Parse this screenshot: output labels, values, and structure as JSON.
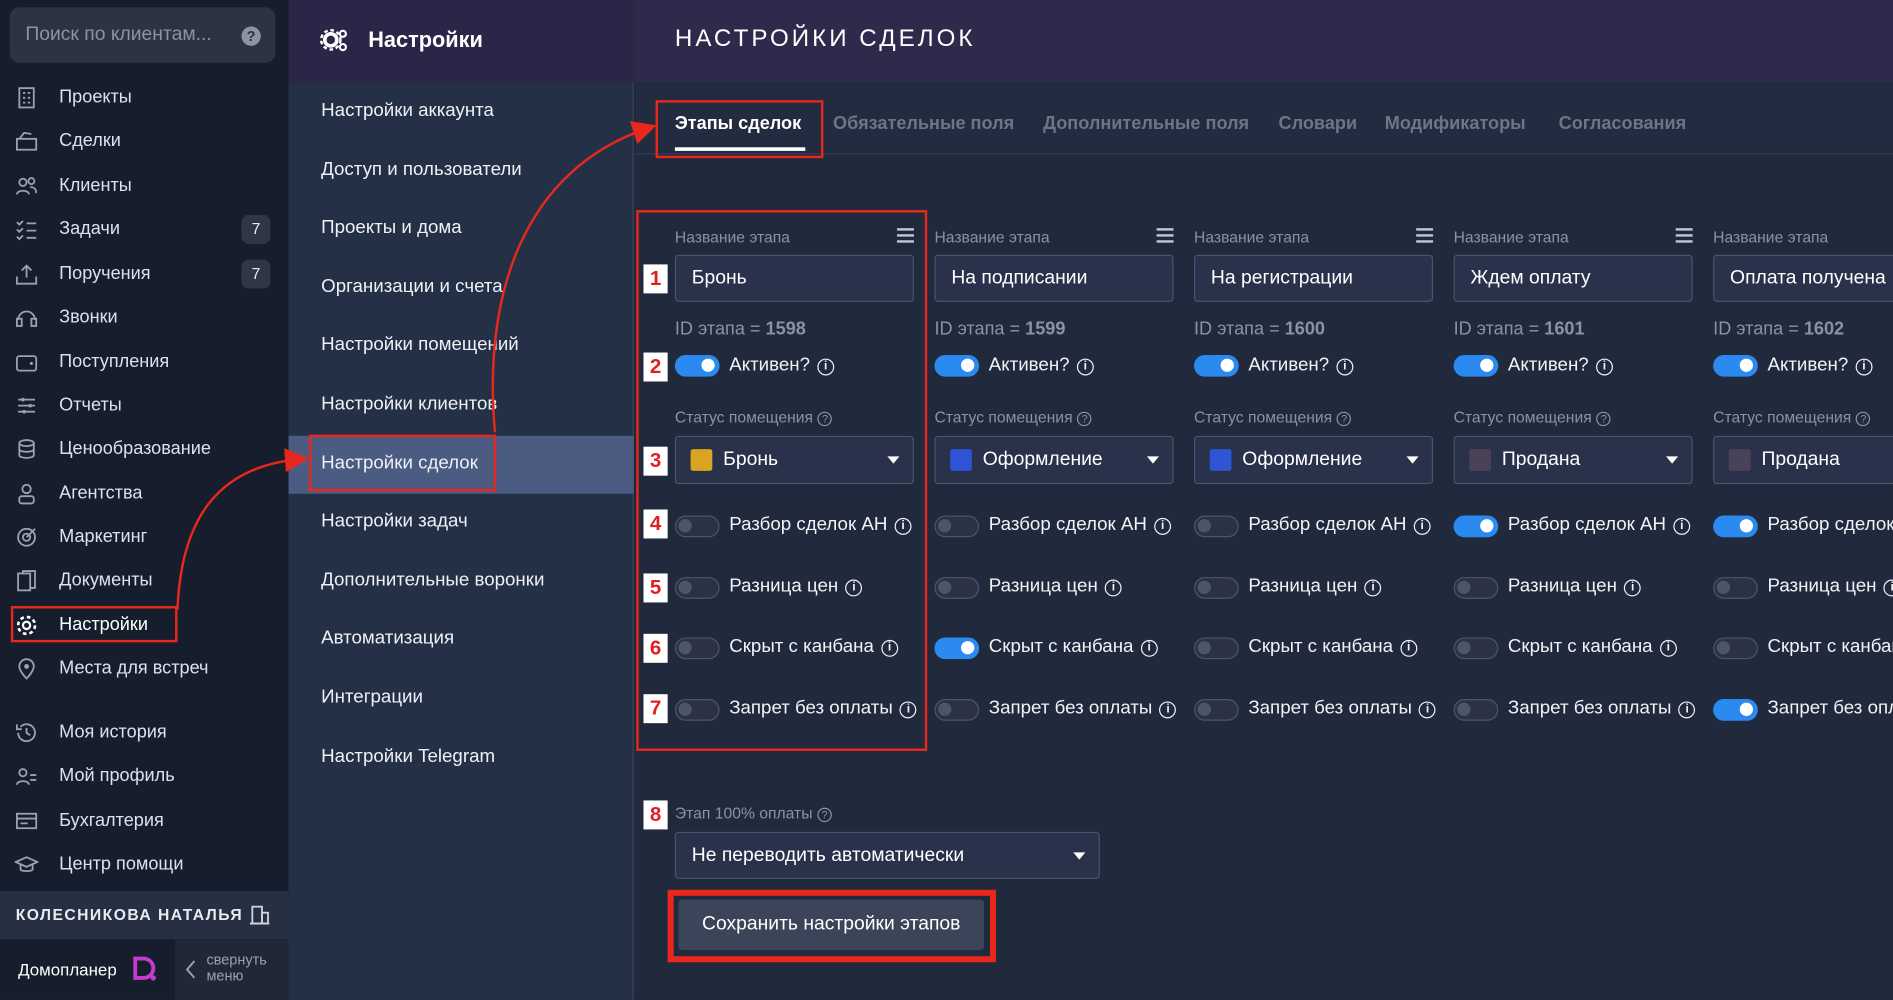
{
  "sidebar": {
    "search_placeholder": "Поиск по клиентам...",
    "items": [
      {
        "label": "Проекты",
        "icon": "building-icon"
      },
      {
        "label": "Сделки",
        "icon": "deals-icon"
      },
      {
        "label": "Клиенты",
        "icon": "users-icon"
      },
      {
        "label": "Задачи",
        "icon": "tasks-icon",
        "badge": "7"
      },
      {
        "label": "Поручения",
        "icon": "assignments-icon",
        "badge": "7"
      },
      {
        "label": "Звонки",
        "icon": "headset-icon"
      },
      {
        "label": "Поступления",
        "icon": "wallet-icon"
      },
      {
        "label": "Отчеты",
        "icon": "reports-icon"
      },
      {
        "label": "Ценообразование",
        "icon": "coins-icon"
      },
      {
        "label": "Агентства",
        "icon": "agent-icon"
      },
      {
        "label": "Маркетинг",
        "icon": "target-icon"
      },
      {
        "label": "Документы",
        "icon": "documents-icon"
      },
      {
        "label": "Настройки",
        "icon": "gear-icon"
      },
      {
        "label": "Места для встреч",
        "icon": "pin-icon"
      },
      {
        "label": "Моя история",
        "icon": "history-icon"
      },
      {
        "label": "Мой профиль",
        "icon": "profile-icon"
      },
      {
        "label": "Бухгалтерия",
        "icon": "accounting-icon"
      },
      {
        "label": "Центр помощи",
        "icon": "graduation-icon"
      }
    ],
    "user_name": "КОЛЕСНИКОВА НАТАЛЬЯ",
    "logo_text": "Домопланер",
    "collapse_label": "свернуть меню"
  },
  "settings_menu": {
    "title": "Настройки",
    "items": [
      "Настройки аккаунта",
      "Доступ и пользователи",
      "Проекты и дома",
      "Организации и счета",
      "Настройки помещений",
      "Настройки клиентов",
      "Настройки сделок",
      "Настройки задач",
      "Дополнительные воронки",
      "Автоматизация",
      "Интеграции",
      "Настройки Telegram"
    ],
    "active": "Настройки сделок"
  },
  "page": {
    "title": "НАСТРОЙКИ СДЕЛОК",
    "tabs": [
      "Этапы сделок",
      "Обязательные поля",
      "Дополнительные поля",
      "Словари",
      "Модификаторы",
      "Согласования"
    ],
    "active_tab": "Этапы сделок"
  },
  "labels": {
    "stage_name": "Название этапа",
    "id_prefix": "ID этапа = ",
    "active": "Активен?",
    "room_status": "Статус помещения",
    "deal_review": "Разбор сделок АН",
    "price_diff": "Разница цен",
    "hidden_kanban": "Скрыт с канбана",
    "no_payment_ban": "Запрет без оплаты"
  },
  "stages": [
    {
      "name": "Бронь",
      "id": "1598",
      "active": true,
      "status": "Бронь",
      "status_color": "#d8a520",
      "deal_review": false,
      "price_diff": false,
      "hidden": false,
      "ban": false
    },
    {
      "name": "На подписании",
      "id": "1599",
      "active": true,
      "status": "Оформление",
      "status_color": "#2f55d4",
      "deal_review": false,
      "price_diff": false,
      "hidden": true,
      "ban": false
    },
    {
      "name": "На регистрации",
      "id": "1600",
      "active": true,
      "status": "Оформление",
      "status_color": "#2f55d4",
      "deal_review": false,
      "price_diff": false,
      "hidden": false,
      "ban": false
    },
    {
      "name": "Ждем оплату",
      "id": "1601",
      "active": true,
      "status": "Продана",
      "status_color": "#4a4256",
      "deal_review": true,
      "price_diff": false,
      "hidden": false,
      "ban": false
    },
    {
      "name": "Оплата получена",
      "id": "1602",
      "active": true,
      "status": "Продана",
      "status_color": "#4a4256",
      "deal_review": true,
      "price_diff": false,
      "hidden": false,
      "ban": true
    }
  ],
  "annotation_numbers": [
    "1",
    "2",
    "3",
    "4",
    "5",
    "6",
    "7",
    "8"
  ],
  "full_payment": {
    "label": "Этап 100% оплаты",
    "value": "Не переводить автоматически"
  },
  "save_button": "Сохранить настройки этапов",
  "accent_red": "#e8281c",
  "toggle_on_color": "#2b8af0"
}
